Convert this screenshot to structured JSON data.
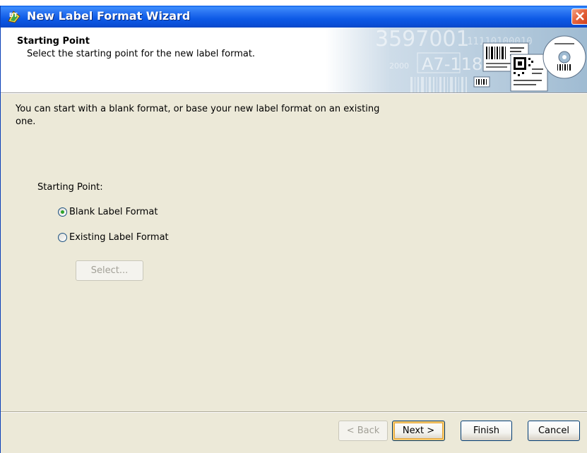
{
  "window": {
    "title": "New Label Format Wizard",
    "icon": "bartender-app-icon"
  },
  "header": {
    "title": "Starting Point",
    "subtitle": "Select the starting point for the new label format.",
    "banner_text": [
      "3597001",
      "A7-118",
      "2000",
      "11110100010"
    ]
  },
  "body": {
    "intro": "You can start with a blank format, or base your new label format on an existing one.",
    "starting_point_label": "Starting Point:",
    "options": [
      {
        "label": "Blank Label Format",
        "checked": true
      },
      {
        "label": "Existing Label Format",
        "checked": false
      }
    ],
    "select_button": "Select..."
  },
  "footer": {
    "back_label": "< Back",
    "next_label": "Next >",
    "finish_label": "Finish",
    "cancel_label": "Cancel"
  },
  "colors": {
    "titlebar": "#0a4fd8",
    "dialog_bg": "#ece9d8",
    "close_button": "#d2401a"
  }
}
